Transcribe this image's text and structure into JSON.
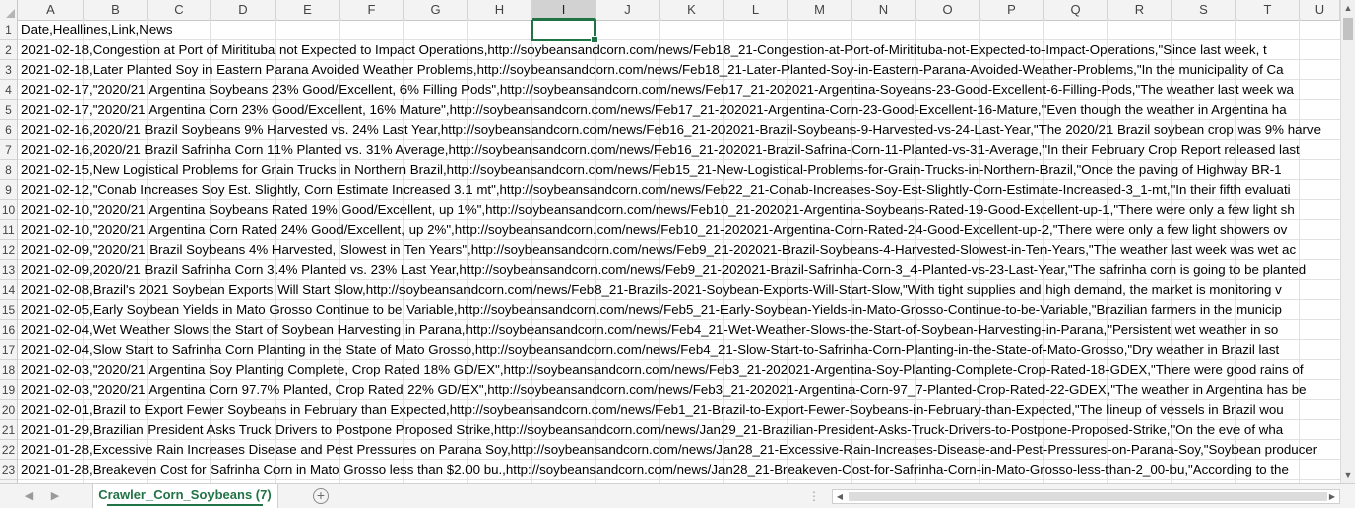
{
  "columns": [
    "A",
    "B",
    "C",
    "D",
    "E",
    "F",
    "G",
    "H",
    "I",
    "J",
    "K",
    "L",
    "M",
    "N",
    "O",
    "P",
    "Q",
    "R",
    "S",
    "T",
    "U"
  ],
  "selected_column": "I",
  "rows": [
    {
      "num": "1",
      "text": "Date,Heallines,Link,News"
    },
    {
      "num": "2",
      "text": "2021-02-18,Congestion at Port of Miritituba not Expected to Impact Operations,http://soybeansandcorn.com/news/Feb18_21-Congestion-at-Port-of-Miritituba-not-Expected-to-Impact-Operations,\"Since last week, t"
    },
    {
      "num": "3",
      "text": "2021-02-18,Later Planted Soy in Eastern Parana Avoided Weather Problems,http://soybeansandcorn.com/news/Feb18_21-Later-Planted-Soy-in-Eastern-Parana-Avoided-Weather-Problems,\"In the municipality of Ca"
    },
    {
      "num": "4",
      "text": "2021-02-17,\"2020/21 Argentina Soybeans 23% Good/Excellent, 6% Filling Pods\",http://soybeansandcorn.com/news/Feb17_21-202021-Argentina-Soyeans-23-Good-Excellent-6-Filling-Pods,\"The weather last week wa"
    },
    {
      "num": "5",
      "text": "2021-02-17,\"2020/21 Argentina Corn 23% Good/Excellent, 16% Mature\",http://soybeansandcorn.com/news/Feb17_21-202021-Argentina-Corn-23-Good-Excellent-16-Mature,\"Even though the weather in Argentina ha"
    },
    {
      "num": "6",
      "text": "2021-02-16,2020/21 Brazil Soybeans 9% Harvested vs. 24% Last Year,http://soybeansandcorn.com/news/Feb16_21-202021-Brazil-Soybeans-9-Harvested-vs-24-Last-Year,\"The 2020/21 Brazil soybean crop was 9% harve"
    },
    {
      "num": "7",
      "text": "2021-02-16,2020/21 Brazil Safrinha Corn 11% Planted vs. 31% Average,http://soybeansandcorn.com/news/Feb16_21-202021-Brazil-Safrina-Corn-11-Planted-vs-31-Average,\"In their February Crop Report released last"
    },
    {
      "num": "8",
      "text": "2021-02-15,New Logistical Problems for Grain Trucks in Northern Brazil,http://soybeansandcorn.com/news/Feb15_21-New-Logistical-Problems-for-Grain-Trucks-in-Northern-Brazil,\"Once the paving of Highway BR-1"
    },
    {
      "num": "9",
      "text": "2021-02-12,\"Conab Increases Soy Est. Slightly, Corn Estimate Increased 3.1 mt\",http://soybeansandcorn.com/news/Feb22_21-Conab-Increases-Soy-Est-Slightly-Corn-Estimate-Increased-3_1-mt,\"In their fifth evaluati"
    },
    {
      "num": "10",
      "text": "2021-02-10,\"2020/21 Argentina Soybeans Rated 19% Good/Excellent, up 1%\",http://soybeansandcorn.com/news/Feb10_21-202021-Argentina-Soybeans-Rated-19-Good-Excellent-up-1,\"There were only a few light sh"
    },
    {
      "num": "11",
      "text": "2021-02-10,\"2020/21 Argentina Corn Rated 24% Good/Excellent, up 2%\",http://soybeansandcorn.com/news/Feb10_21-202021-Argentina-Corn-Rated-24-Good-Excellent-up-2,\"There were only a few light showers ov"
    },
    {
      "num": "12",
      "text": "2021-02-09,\"2020/21 Brazil Soybeans 4% Harvested, Slowest in Ten Years\",http://soybeansandcorn.com/news/Feb9_21-202021-Brazil-Soybeans-4-Harvested-Slowest-in-Ten-Years,\"The weather last week was wet ac"
    },
    {
      "num": "13",
      "text": "2021-02-09,2020/21 Brazil Safrinha Corn 3.4% Planted vs. 23% Last Year,http://soybeansandcorn.com/news/Feb9_21-202021-Brazil-Safrinha-Corn-3_4-Planted-vs-23-Last-Year,\"The safrinha corn is going to be planted"
    },
    {
      "num": "14",
      "text": "2021-02-08,Brazil's 2021 Soybean Exports Will Start Slow,http://soybeansandcorn.com/news/Feb8_21-Brazils-2021-Soybean-Exports-Will-Start-Slow,\"With tight supplies and high demand, the market is monitoring v"
    },
    {
      "num": "15",
      "text": "2021-02-05,Early Soybean Yields in Mato Grosso Continue to be Variable,http://soybeansandcorn.com/news/Feb5_21-Early-Soybean-Yields-in-Mato-Grosso-Continue-to-be-Variable,\"Brazilian farmers in the municip"
    },
    {
      "num": "16",
      "text": "2021-02-04,Wet Weather Slows the Start of Soybean Harvesting in Parana,http://soybeansandcorn.com/news/Feb4_21-Wet-Weather-Slows-the-Start-of-Soybean-Harvesting-in-Parana,\"Persistent wet weather in so"
    },
    {
      "num": "17",
      "text": "2021-02-04,Slow Start to Safrinha Corn Planting in the State of Mato Grosso,http://soybeansandcorn.com/news/Feb4_21-Slow-Start-to-Safrinha-Corn-Planting-in-the-State-of-Mato-Grosso,\"Dry weather in Brazil last"
    },
    {
      "num": "18",
      "text": "2021-02-03,\"2020/21 Argentina Soy Planting Complete, Crop Rated 18% GD/EX\",http://soybeansandcorn.com/news/Feb3_21-202021-Argentina-Soy-Planting-Complete-Crop-Rated-18-GDEX,\"There were good rains of"
    },
    {
      "num": "19",
      "text": "2021-02-03,\"2020/21 Argentina Corn 97.7% Planted, Crop Rated 22% GD/EX\",http://soybeansandcorn.com/news/Feb3_21-202021-Argentina-Corn-97_7-Planted-Crop-Rated-22-GDEX,\"The weather in Argentina has be"
    },
    {
      "num": "20",
      "text": "2021-02-01,Brazil to Export Fewer Soybeans in February than Expected,http://soybeansandcorn.com/news/Feb1_21-Brazil-to-Export-Fewer-Soybeans-in-February-than-Expected,\"The lineup of vessels in Brazil wou"
    },
    {
      "num": "21",
      "text": "2021-01-29,Brazilian President Asks Truck Drivers to Postpone Proposed Strike,http://soybeansandcorn.com/news/Jan29_21-Brazilian-President-Asks-Truck-Drivers-to-Postpone-Proposed-Strike,\"On the eve of wha"
    },
    {
      "num": "22",
      "text": "2021-01-28,Excessive Rain Increases Disease and Pest Pressures on Parana Soy,http://soybeansandcorn.com/news/Jan28_21-Excessive-Rain-Increases-Disease-and-Pest-Pressures-on-Parana-Soy,\"Soybean producer"
    },
    {
      "num": "23",
      "text": "2021-01-28,Breakeven Cost for Safrinha Corn in Mato Grosso less than $2.00 bu.,http://soybeansandcorn.com/news/Jan28_21-Breakeven-Cost-for-Safrinha-Corn-in-Mato-Grosso-less-than-2_00-bu,\"According to the"
    }
  ],
  "sheet_tab": {
    "label": "Crawler_Corn_Soybeans (7)"
  },
  "icons": {
    "add_sheet": "plus-circle-icon",
    "prev_sheet": "triangle-left-icon",
    "next_sheet": "triangle-right-icon"
  },
  "colors": {
    "accent": "#217346"
  }
}
